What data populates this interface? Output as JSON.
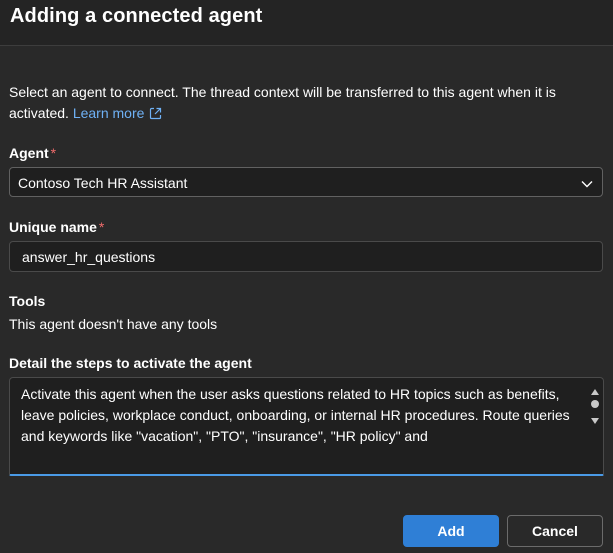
{
  "dialog": {
    "title": "Adding a connected agent",
    "intro_text": "Select an agent to connect. The thread context will be transferred to this agent when it is activated.",
    "learn_more_label": "Learn more"
  },
  "agent_field": {
    "label": "Agent",
    "required_mark": "*",
    "selected_value": "Contoso Tech HR Assistant"
  },
  "unique_name_field": {
    "label": "Unique name",
    "required_mark": "*",
    "value": "answer_hr_questions"
  },
  "tools_section": {
    "label": "Tools",
    "text": "This agent doesn't have any tools"
  },
  "steps_field": {
    "label": "Detail the steps to activate the agent",
    "value": "Activate this agent when the user asks questions related to HR topics such as benefits, leave policies, workplace conduct, onboarding, or internal HR procedures. Route queries and keywords like \"vacation\", \"PTO\", \"insurance\", \"HR policy\" and"
  },
  "footer": {
    "add_label": "Add",
    "cancel_label": "Cancel"
  },
  "colors": {
    "background": "#292929",
    "link": "#6fb1f5",
    "primary_button": "#2f7fd6",
    "required": "#f06b6b",
    "focus_border": "#4a9ae6"
  },
  "icons": {
    "learn_more": "external-link-icon",
    "select": "chevron-down-icon",
    "scroll_up": "caret-up-icon",
    "scroll_down": "caret-down-icon"
  }
}
